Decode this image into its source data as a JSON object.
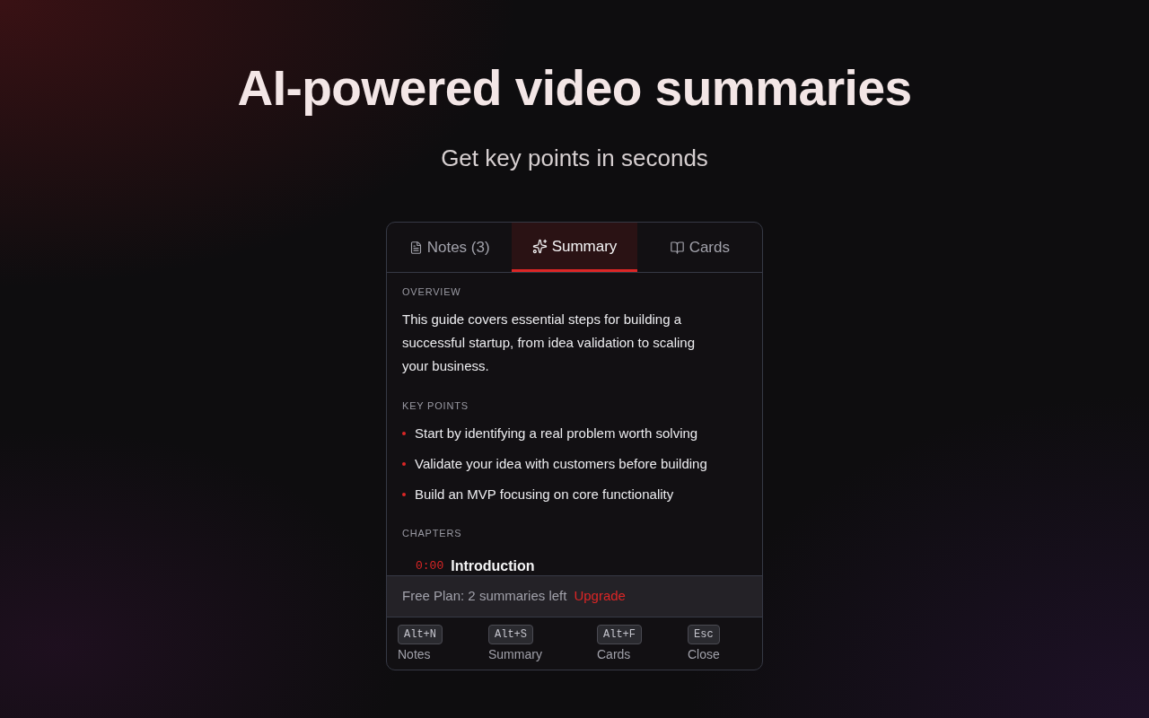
{
  "hero": {
    "title": "AI-powered video summaries",
    "subtitle": "Get key points in seconds"
  },
  "panel": {
    "tabs": [
      {
        "kind": "notes",
        "label": "Notes (3)",
        "selected": false
      },
      {
        "kind": "summary",
        "label": "Summary",
        "selected": true
      },
      {
        "kind": "cards",
        "label": "Cards",
        "selected": false
      }
    ],
    "overview": {
      "heading": "OVERVIEW",
      "text": "This guide covers essential steps for building a successful startup, from idea validation to scaling your business."
    },
    "key_points": {
      "heading": "KEY POINTS",
      "items": [
        "Start by identifying a real problem worth solving",
        "Validate your idea with customers before building",
        "Build an MVP focusing on core functionality"
      ]
    },
    "chapters": {
      "heading": "CHAPTERS",
      "items": [
        {
          "time": "0:00",
          "title": "Introduction"
        }
      ]
    },
    "plan_bar": {
      "text": "Free Plan: 2 summaries left",
      "link": "Upgrade"
    },
    "shortcuts": [
      {
        "key": "Alt+N",
        "label": "Notes"
      },
      {
        "key": "Alt+S",
        "label": "Summary"
      },
      {
        "key": "Alt+F",
        "label": "Cards"
      },
      {
        "key": "Esc",
        "label": "Close"
      }
    ]
  }
}
